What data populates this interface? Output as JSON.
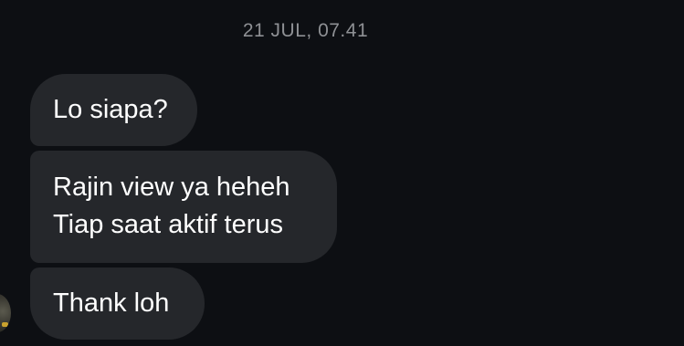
{
  "conversation": {
    "timestamp": "21 JUL, 07.41",
    "messages": [
      {
        "lines": [
          "Lo siapa?"
        ]
      },
      {
        "lines": [
          "Rajin view ya heheh",
          "Tiap saat aktif terus"
        ]
      },
      {
        "lines": [
          "Thank loh"
        ]
      }
    ]
  },
  "theme": {
    "background": "#0d0f13",
    "bubble": "#25272b",
    "text": "#ffffff",
    "timestamp": "#8e9094"
  }
}
